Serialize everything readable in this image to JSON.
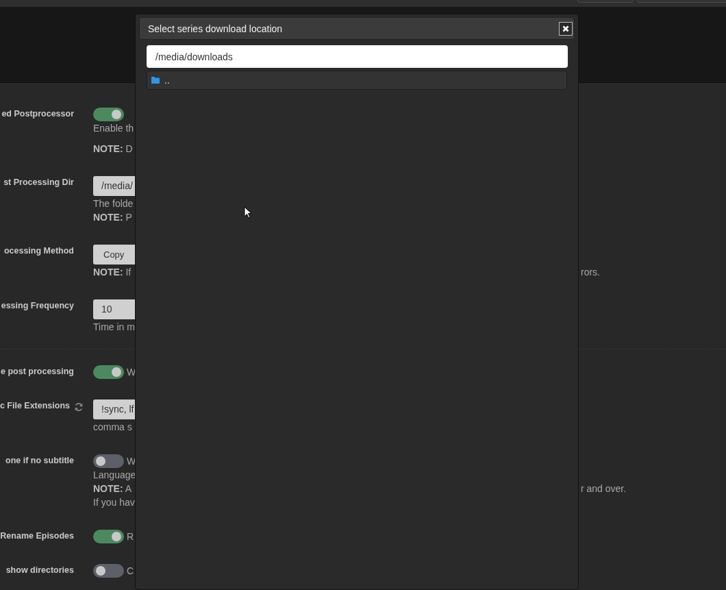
{
  "settings": [
    {
      "label": "ed Postprocessor",
      "control": {
        "kind": "toggle",
        "on": true
      },
      "lines": [
        {
          "text": "Enable th"
        },
        {
          "text": "**NOTE:** D",
          "spaced": true
        }
      ]
    },
    {
      "label": "st Processing Dir",
      "control": {
        "kind": "input",
        "value": "/media/"
      },
      "lines": [
        {
          "text": "The folde"
        },
        {
          "text": "**NOTE:** P"
        }
      ]
    },
    {
      "label": "ocessing Method",
      "control": {
        "kind": "select",
        "value": "Copy"
      },
      "lines": [
        {
          "text": "**NOTE:** If",
          "tail": "rors."
        }
      ]
    },
    {
      "label": "essing Frequency",
      "control": {
        "kind": "input",
        "value": "10"
      },
      "lines": [
        {
          "text": "Time in m"
        }
      ]
    },
    {
      "label": "e post processing",
      "divider": true,
      "control": {
        "kind": "toggle",
        "on": true,
        "text": "W"
      }
    },
    {
      "label": "c File Extensions",
      "sync_icon": true,
      "control": {
        "kind": "input",
        "value": "!sync, lf"
      },
      "lines": [
        {
          "text": "comma s"
        }
      ]
    },
    {
      "label": "one if no subtitle",
      "control": {
        "kind": "toggle",
        "on": false,
        "text": "W"
      },
      "lines": [
        {
          "text": "Language"
        },
        {
          "text": "**NOTE:** A",
          "tail": "r and over."
        },
        {
          "text": "If you hav"
        }
      ]
    },
    {
      "label": "Rename Episodes",
      "control": {
        "kind": "toggle",
        "on": true,
        "text": "R"
      }
    },
    {
      "label": "show directories",
      "control": {
        "kind": "toggle",
        "on": false,
        "text": "C"
      }
    }
  ],
  "dialog": {
    "title": "Select series download location",
    "path": "/media/downloads",
    "entries": [
      {
        "name": ".."
      }
    ]
  }
}
